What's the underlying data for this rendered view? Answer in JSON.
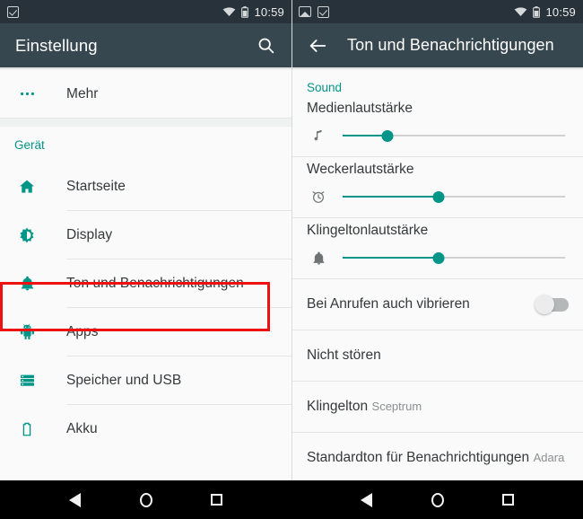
{
  "statusbar": {
    "left_panel_icons": [
      "check-box-icon"
    ],
    "right_panel_icons": [
      "screenshot-image-icon",
      "check-box-icon"
    ],
    "signal_icons": [
      "wifi-icon",
      "battery-icon"
    ],
    "time": "10:59"
  },
  "left_panel": {
    "appbar": {
      "title": "Einstellung",
      "search_icon": "search-icon"
    },
    "top_item": {
      "icon": "more-dots-icon",
      "label": "Mehr"
    },
    "group_header": "Gerät",
    "items": [
      {
        "icon": "home-icon",
        "label": "Startseite",
        "highlighted": false
      },
      {
        "icon": "brightness-icon",
        "label": "Display",
        "highlighted": false
      },
      {
        "icon": "bell-icon",
        "label": "Ton und Benachrichtigungen",
        "highlighted": true
      },
      {
        "icon": "android-icon",
        "label": "Apps",
        "highlighted": false
      },
      {
        "icon": "storage-icon",
        "label": "Speicher und USB",
        "highlighted": false
      },
      {
        "icon": "battery-icon",
        "label": "Akku",
        "highlighted": false
      }
    ],
    "highlight_color": "#ee1111",
    "accent_color": "#009587"
  },
  "right_panel": {
    "appbar": {
      "back_icon": "arrow-back-icon",
      "title": "Ton und Benachrichtigungen"
    },
    "section_header": "Sound",
    "sliders": [
      {
        "label": "Medienlautstärke",
        "icon": "music-note-icon",
        "value": 20
      },
      {
        "label": "Weckerlautstärke",
        "icon": "alarm-clock-icon",
        "value": 43
      },
      {
        "label": "Klingeltonlautstärke",
        "icon": "bell-icon",
        "value": 43
      }
    ],
    "toggle_row": {
      "label": "Bei Anrufen auch vibrieren",
      "state": "off"
    },
    "rows": [
      {
        "title": "Nicht stören",
        "subtitle": ""
      },
      {
        "title": "Klingelton",
        "subtitle": "Sceptrum"
      },
      {
        "title": "Standardton für Benachrichtigungen",
        "subtitle": "Adara"
      }
    ],
    "accent_color": "#009587"
  },
  "navbar": {
    "buttons": [
      "back-triangle-icon",
      "home-circle-icon",
      "recents-square-icon"
    ]
  }
}
